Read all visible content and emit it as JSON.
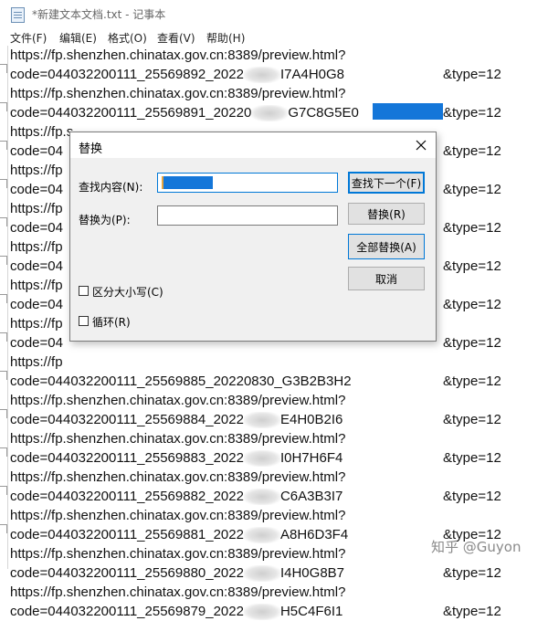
{
  "window": {
    "title": "*新建文本文档.txt - 记事本"
  },
  "menu": [
    "文件(F)",
    "编辑(E)",
    "格式(O)",
    "查看(V)",
    "帮助(H)"
  ],
  "editor_lines": [
    "https://fp.shenzhen.chinatax.gov.cn:8389/preview.html?",
    "code=044032200111_25569892_2022",
    "I7A4H0G8",
    "&type=12",
    "https://fp.shenzhen.chinatax.gov.cn:8389/preview.html?",
    "code=044032200111_25569891_20220",
    "G7C8G5E0",
    "&type=12",
    "https://fp.s",
    "code=04",
    "&type=12",
    "https://fp",
    "code=04",
    "&type=12",
    "https://fp",
    "code=04",
    "&type=12",
    "https://fp",
    "code=04",
    "&type=12",
    "https://fp",
    "code=04",
    "&type=12",
    "https://fp",
    "code=04",
    "&type=12",
    "https://fp",
    "code=044032200111_25569885_20220830_G3B2B3H2",
    "&type=12",
    "https://fp.shenzhen.chinatax.gov.cn:8389/preview.html?",
    "code=044032200111_25569884_2022",
    "E4H0B2I6",
    "&type=12",
    "https://fp.shenzhen.chinatax.gov.cn:8389/preview.html?",
    "code=044032200111_25569883_2022",
    "I0H7H6F4",
    "&type=12",
    "https://fp.shenzhen.chinatax.gov.cn:8389/preview.html?",
    "code=044032200111_25569882_2022",
    "C6A3B3I7",
    "&type=12",
    "https://fp.shenzhen.chinatax.gov.cn:8389/preview.html?",
    "code=044032200111_25569881_2022",
    "A8H6D3F4",
    "&type=12",
    "https://fp.shenzhen.chinatax.gov.cn:8389/preview.html?",
    "code=044032200111_25569880_2022",
    "I4H0G8B7",
    "&type=12",
    "https://fp.shenzhen.chinatax.gov.cn:8389/preview.html?",
    "code=044032200111_25569879_2022",
    "H5C4F6I1",
    "&type=12"
  ],
  "dialog": {
    "title": "替换",
    "find_label": "查找内容(N):",
    "replace_label": "替换为(P):",
    "match_case_label": "区分大小写(C)",
    "wrap_label": "循环(R)",
    "buttons": {
      "find_next": "查找下一个(F)",
      "replace": "替换(R)",
      "replace_all": "全部替换(A)",
      "cancel": "取消"
    }
  },
  "watermark": "知乎 @Guyon",
  "colors": {
    "selection": "#1476d9",
    "accent": "#0078d7"
  }
}
